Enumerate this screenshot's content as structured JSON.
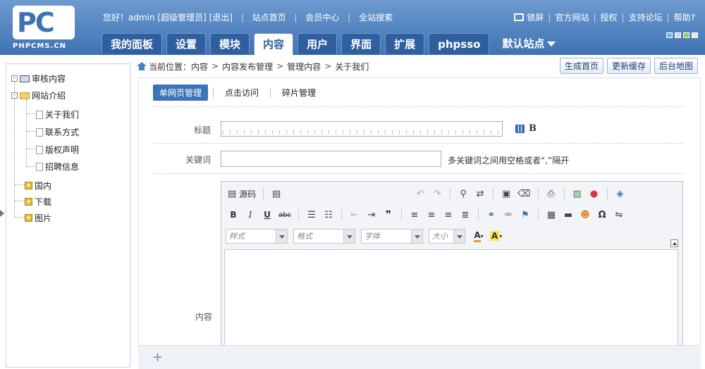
{
  "header": {
    "logo_main": "PC",
    "logo_sub": "PHPCMS.CN",
    "greeting": "您好！admin [超级管理员]",
    "logout": "[退出]",
    "links": [
      "站点首页",
      "会员中心",
      "全站搜索"
    ],
    "right_links": [
      "锁屏",
      "官方网站",
      "授权",
      "支持论坛",
      "帮助?"
    ],
    "skin_colors": [
      "#7fb3e8",
      "#d9d9d9",
      "#9acb58",
      "#e8e8e8"
    ]
  },
  "mainnav": {
    "tabs": [
      "我的面板",
      "设置",
      "模块",
      "内容",
      "用户",
      "界面",
      "扩展",
      "phpsso"
    ],
    "active": "内容",
    "site_switch": "默认站点"
  },
  "tree": {
    "review": "审核内容",
    "site_intro": "网站介绍",
    "pages": [
      "关于我们",
      "联系方式",
      "版权声明",
      "招聘信息"
    ],
    "categories": [
      "国内",
      "下载",
      "图片"
    ]
  },
  "breadcrumb": {
    "prefix": "当前位置：",
    "items": [
      "内容",
      "内容发布管理",
      "管理内容",
      "关于我们"
    ]
  },
  "actions": [
    "生成首页",
    "更新缓存",
    "后台地图"
  ],
  "subtabs": [
    "单网页管理",
    "点击访问",
    "碎片管理"
  ],
  "form": {
    "title_label": "标题",
    "keywords_label": "关键词",
    "keywords_hint": "多关键词之间用空格或者“,”隔开",
    "content_label": "内容",
    "title_value": "",
    "keywords_value": ""
  },
  "editor": {
    "source_label": "源码",
    "dropdowns": [
      "样式",
      "格式",
      "字体",
      "大小"
    ]
  }
}
